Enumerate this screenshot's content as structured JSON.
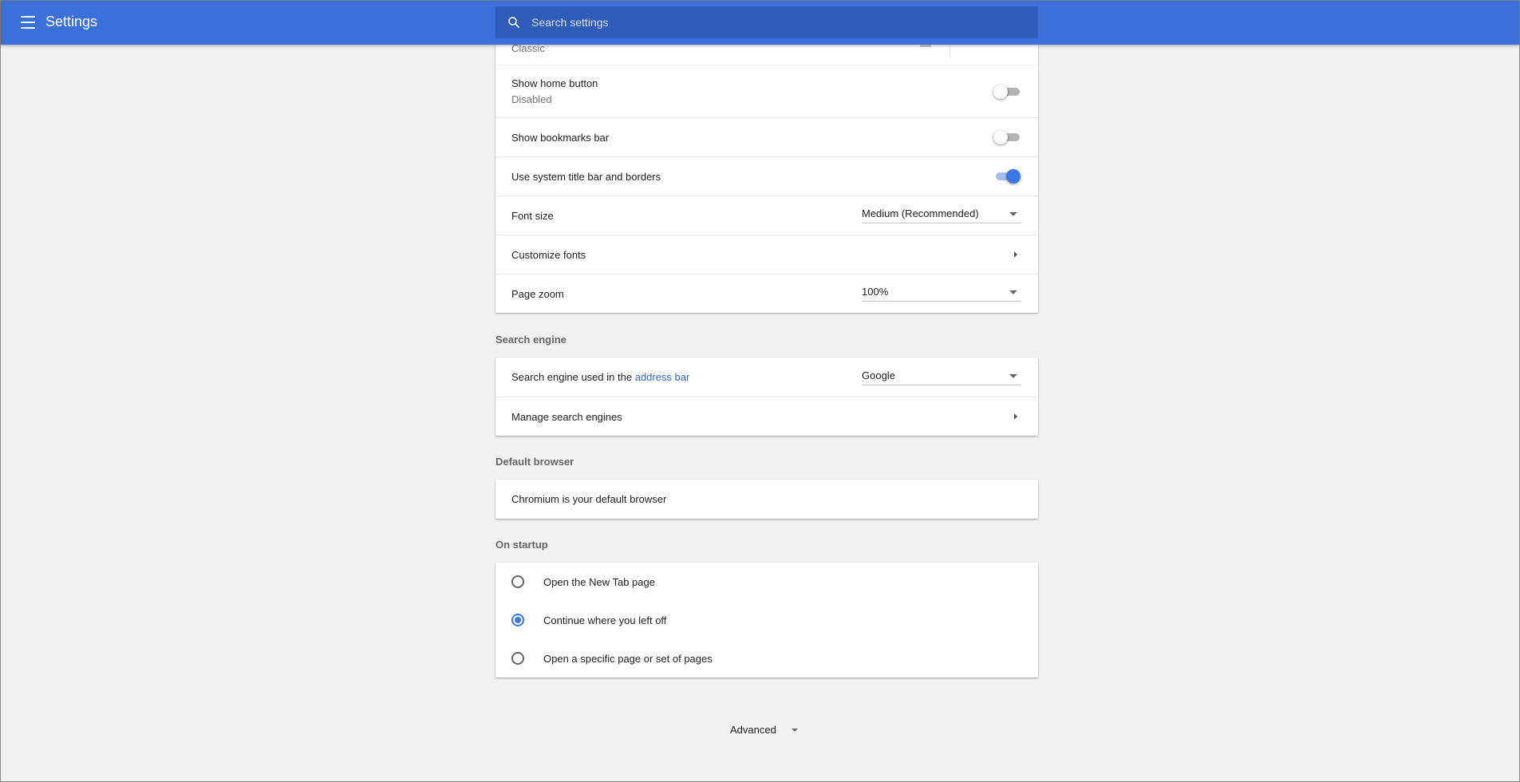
{
  "toolbar": {
    "title": "Settings",
    "search_placeholder": "Search settings"
  },
  "appearance": {
    "partial_label": "Classic",
    "rows": [
      {
        "label": "Show home button",
        "sub": "Disabled",
        "toggle": false
      },
      {
        "label": "Show bookmarks bar",
        "toggle": false
      },
      {
        "label": "Use system title bar and borders",
        "toggle": true
      }
    ],
    "font_size": {
      "label": "Font size",
      "value": "Medium (Recommended)"
    },
    "customize_fonts": {
      "label": "Customize fonts"
    },
    "page_zoom": {
      "label": "Page zoom",
      "value": "100%"
    }
  },
  "search_engine": {
    "title": "Search engine",
    "used_prefix": "Search engine used in the",
    "used_link": "address bar",
    "value": "Google",
    "manage_label": "Manage search engines"
  },
  "default_browser": {
    "title": "Default browser",
    "status": "Chromium is your default browser"
  },
  "on_startup": {
    "title": "On startup",
    "options": [
      {
        "label": "Open the New Tab page",
        "checked": false
      },
      {
        "label": "Continue where you left off",
        "checked": true
      },
      {
        "label": "Open a specific page or set of pages",
        "checked": false
      }
    ]
  },
  "advanced_label": "Advanced",
  "colors": {
    "toolbar": "#3b6fd9",
    "accent": "#3b78e7",
    "link": "#3367d6"
  }
}
